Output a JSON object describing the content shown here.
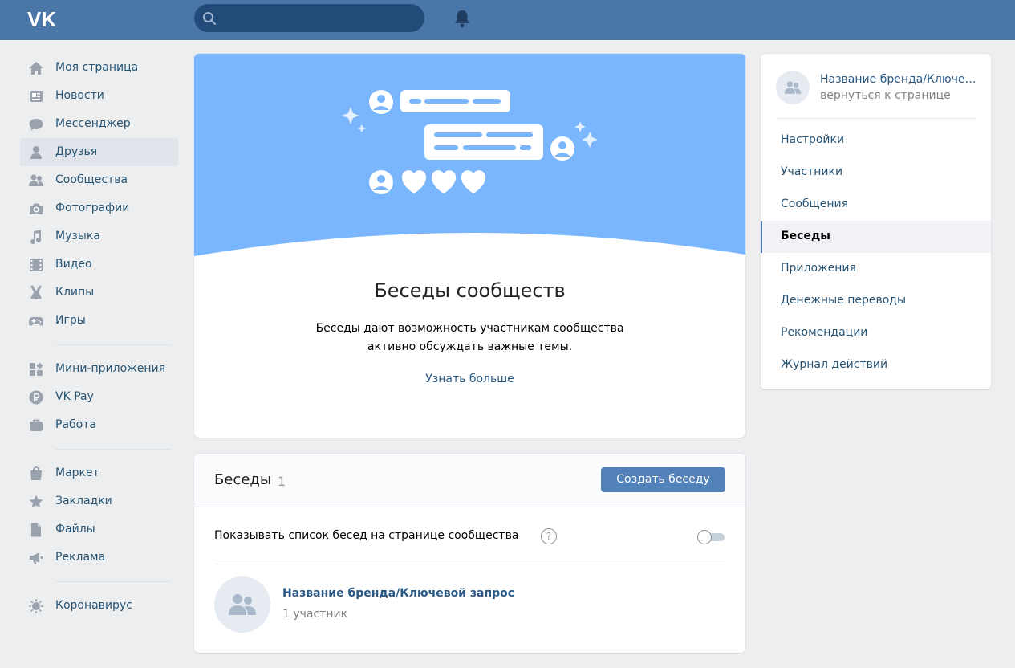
{
  "header": {
    "logo": "VK",
    "search_placeholder": "",
    "icons": [
      "search-icon",
      "bell-icon"
    ]
  },
  "sidebar": {
    "groups": [
      [
        {
          "label": "Моя страница",
          "icon": "home-icon"
        },
        {
          "label": "Новости",
          "icon": "news-icon"
        },
        {
          "label": "Мессенджер",
          "icon": "messenger-icon"
        },
        {
          "label": "Друзья",
          "icon": "friends-icon",
          "active": true
        },
        {
          "label": "Сообщества",
          "icon": "communities-icon"
        },
        {
          "label": "Фотографии",
          "icon": "camera-icon"
        },
        {
          "label": "Музыка",
          "icon": "music-icon"
        },
        {
          "label": "Видео",
          "icon": "video-icon"
        },
        {
          "label": "Клипы",
          "icon": "clips-icon"
        },
        {
          "label": "Игры",
          "icon": "gamepad-icon"
        }
      ],
      [
        {
          "label": "Мини-приложения",
          "icon": "mini-apps-icon"
        },
        {
          "label": "VK Pay",
          "icon": "vkpay-icon"
        },
        {
          "label": "Работа",
          "icon": "briefcase-icon"
        }
      ],
      [
        {
          "label": "Маркет",
          "icon": "shopping-bag-icon"
        },
        {
          "label": "Закладки",
          "icon": "star-icon"
        },
        {
          "label": "Файлы",
          "icon": "file-icon"
        },
        {
          "label": "Реклама",
          "icon": "megaphone-icon"
        }
      ],
      [
        {
          "label": "Коронавирус",
          "icon": "virus-icon"
        }
      ]
    ]
  },
  "promo": {
    "title": "Беседы сообществ",
    "description_line1": "Беседы дают возможность участникам сообщества",
    "description_line2": "активно обсуждать важные темы.",
    "link": "Узнать больше",
    "colors": {
      "hero_bg": "#7ab6fd",
      "hero_shapes": "#ffffff"
    }
  },
  "chats": {
    "title": "Беседы",
    "count": "1",
    "create_button": "Создать беседу",
    "show_list_label": "Показывать список бесед на странице сообщества",
    "help": "?",
    "toggle_on": false,
    "items": [
      {
        "name": "Название бренда/Ключевой запрос",
        "members": "1 участник"
      }
    ]
  },
  "right_menu": {
    "group_name": "Название бренда/Ключевой запрос",
    "back_link": "вернуться к странице",
    "items": [
      {
        "label": "Настройки"
      },
      {
        "label": "Участники"
      },
      {
        "label": "Сообщения"
      },
      {
        "label": "Беседы",
        "active": true
      },
      {
        "label": "Приложения"
      },
      {
        "label": "Денежные переводы"
      },
      {
        "label": "Рекомендации"
      },
      {
        "label": "Журнал действий"
      }
    ]
  },
  "colors": {
    "header_bg": "#4a76a8",
    "page_bg": "#edeef0",
    "link": "#2a5885",
    "button": "#5181b8"
  }
}
